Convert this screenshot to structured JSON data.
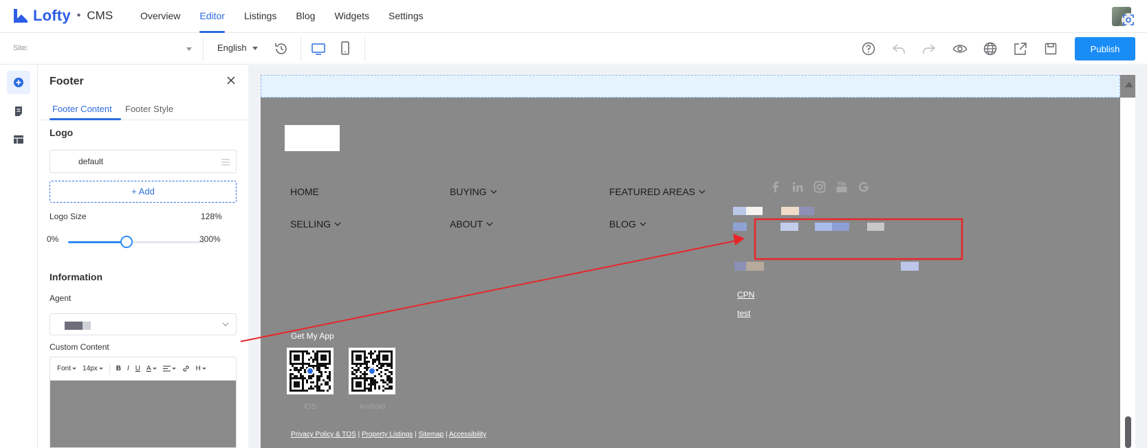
{
  "brand": {
    "name": "Lofty",
    "separator": "•",
    "product": "CMS"
  },
  "nav": [
    {
      "label": "Overview"
    },
    {
      "label": "Editor"
    },
    {
      "label": "Listings"
    },
    {
      "label": "Blog"
    },
    {
      "label": "Widgets"
    },
    {
      "label": "Settings"
    }
  ],
  "nav_active": "Editor",
  "toolbar": {
    "site_label": "Site:",
    "language": "English",
    "publish_label": "Publish"
  },
  "panel": {
    "title": "Footer",
    "tabs": {
      "content": "Footer Content",
      "style": "Footer Style"
    },
    "logo": {
      "heading": "Logo",
      "value": "default",
      "add_label": "+ Add",
      "size_label": "Logo Size",
      "size_value": "128%",
      "range_min": "0%",
      "range_max": "300%",
      "slider_fraction": 0.427
    },
    "information": {
      "heading": "Information",
      "agent_label": "Agent",
      "custom_content_label": "Custom Content"
    },
    "editor_toolbar": {
      "font": "Font",
      "size": "14px",
      "bold": "B",
      "italic": "I",
      "underline": "U",
      "color": "A",
      "heading": "H"
    }
  },
  "preview": {
    "menu": {
      "home": "HOME",
      "buying": "BUYING",
      "featured_areas": "FEATURED AREAS",
      "selling": "SELLING",
      "about": "ABOUT",
      "blog": "BLOG"
    },
    "links": {
      "cpn": "CPN",
      "test": "test"
    },
    "get_app": "Get My App",
    "qr_ios": "iOS",
    "qr_android": "Android",
    "legal": {
      "privacy": "Privacy Policy & TOS",
      "listings": "Property Listings",
      "sitemap": "Sitemap",
      "accessibility": "Accessibility",
      "sep": "|"
    }
  },
  "colors": {
    "accent": "#2c6ce0",
    "publish": "#1a8cf5",
    "canvas_bg": "#898989",
    "annotation": "#e8262a"
  }
}
